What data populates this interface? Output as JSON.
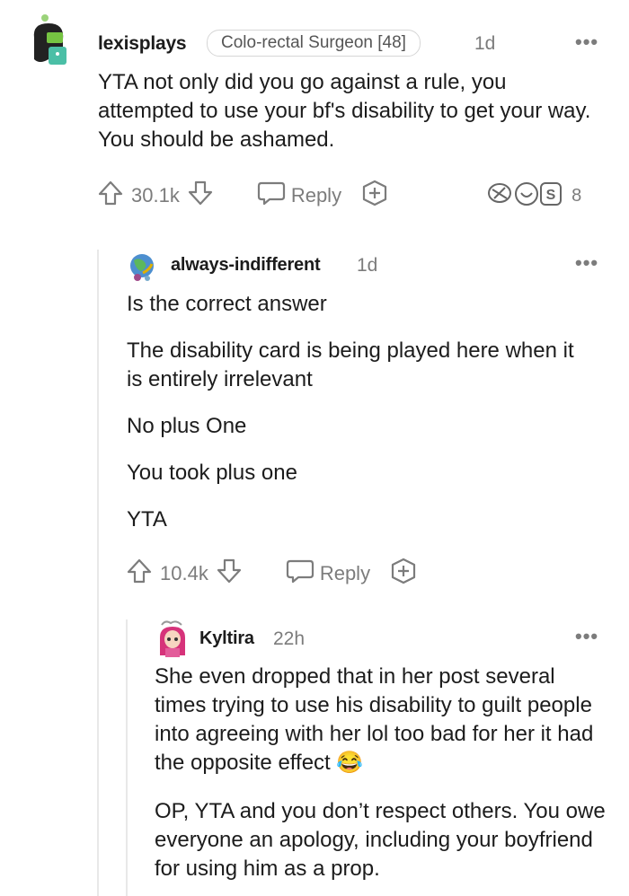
{
  "comments": [
    {
      "username": "lexisplays",
      "flair": "Colo-rectal Surgeon [48]",
      "time": "1d",
      "paragraphs": [
        "YTA not only did you go against a rule, you attempted to use your bf's disability to get your way. You should be ashamed."
      ],
      "upvotes": "30.1k",
      "reply_label": "Reply",
      "awards_count": "8"
    },
    {
      "username": "always-indifferent",
      "time": "1d",
      "paragraphs": [
        "Is the correct answer",
        "The disability card is being played here when it is entirely irrelevant",
        "No plus One",
        "You took plus one",
        "YTA"
      ],
      "upvotes": "10.4k",
      "reply_label": "Reply"
    },
    {
      "username": "Kyltira",
      "time": "22h",
      "paragraphs": [
        "She even dropped that in her post several times trying to use his disability to guilt people into agreeing with her lol too bad for her it had the opposite effect",
        "OP, YTA and you don’t respect others. You owe everyone an apology, including your boyfriend for using him as a prop."
      ],
      "emoji": "😂"
    }
  ],
  "more_label": "•••",
  "colors": {
    "accent": "#7c7c7c",
    "text": "#1c1c1c",
    "thread": "#e8e8e8"
  }
}
